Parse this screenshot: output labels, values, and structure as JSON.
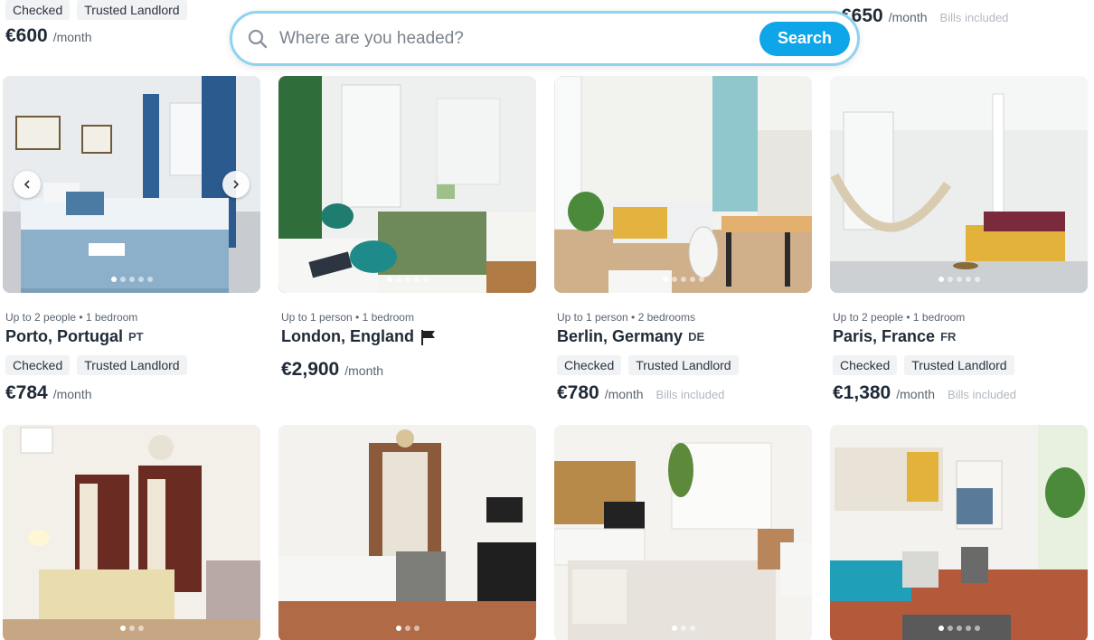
{
  "search": {
    "placeholder": "Where are you headed?",
    "button_label": "Search"
  },
  "top_row": [
    {
      "tags": [
        "Checked",
        "Trusted Landlord"
      ],
      "price": "€600",
      "per": "/month"
    },
    {
      "price": "€650",
      "per": "/month",
      "bills": "Bills included"
    }
  ],
  "listings": [
    {
      "meta": "Up to 2 people • 1 bedroom",
      "city": "Porto, Portugal",
      "cc": "PT",
      "tags": [
        "Checked",
        "Trusted Landlord"
      ],
      "price": "€784",
      "per": "/month",
      "bills": ""
    },
    {
      "meta": "Up to 1 person • 1 bedroom",
      "city": "London, England",
      "cc": "",
      "tags": [],
      "price": "€2,900",
      "per": "/month",
      "bills": ""
    },
    {
      "meta": "Up to 1 person • 2 bedrooms",
      "city": "Berlin, Germany",
      "cc": "DE",
      "tags": [
        "Checked",
        "Trusted Landlord"
      ],
      "price": "€780",
      "per": "/month",
      "bills": "Bills included"
    },
    {
      "meta": "Up to 2 people • 1 bedroom",
      "city": "Paris, France",
      "cc": "FR",
      "tags": [
        "Checked",
        "Trusted Landlord"
      ],
      "price": "€1,380",
      "per": "/month",
      "bills": "Bills included"
    }
  ],
  "colors": {
    "accent": "#0ea5e9",
    "search_border": "#8ed3ef"
  }
}
